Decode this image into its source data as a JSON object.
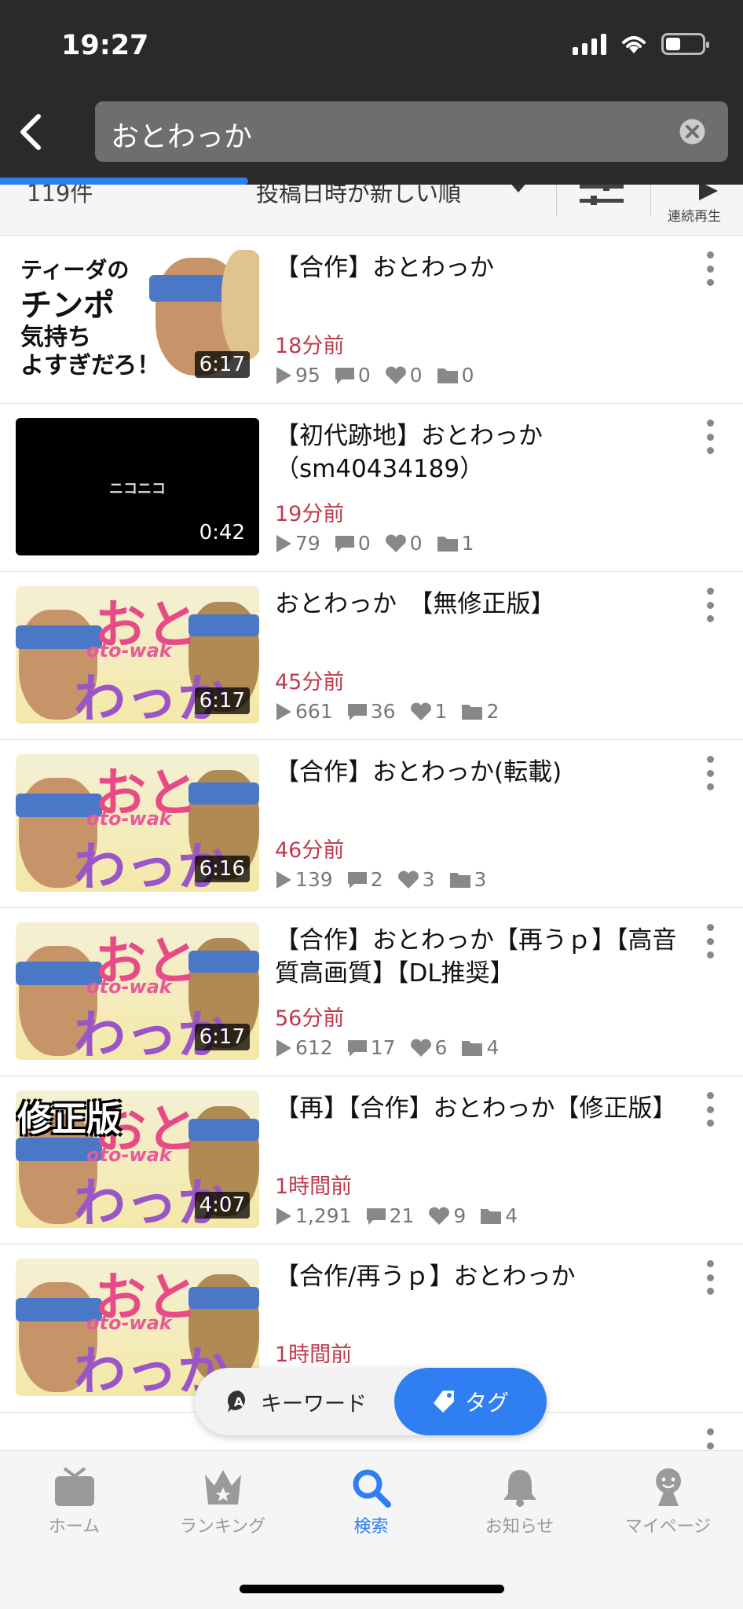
{
  "status_bar": {
    "time": "19:27"
  },
  "search": {
    "query": "おとわっか"
  },
  "sort_bar": {
    "result_count": "119件",
    "sort_order": "投稿日時が新しい順",
    "continuous_play": "連続再生"
  },
  "videos": [
    {
      "title": "【合作】おとわっか",
      "duration": "6:17",
      "posted": "18分前",
      "views": "95",
      "comments": "0",
      "likes": "0",
      "mylists": "0",
      "thumb_text": [
        "ティーダの",
        "チンポ",
        "気持ち",
        "よすぎだろ！"
      ]
    },
    {
      "title": "【初代跡地】おとわっか（sm40434189）",
      "duration": "0:42",
      "posted": "19分前",
      "views": "79",
      "comments": "0",
      "likes": "0",
      "mylists": "1",
      "thumb_text": [
        "ニコニコ"
      ]
    },
    {
      "title": "おとわっか　【無修正版】",
      "duration": "6:17",
      "posted": "45分前",
      "views": "661",
      "comments": "36",
      "likes": "1",
      "mylists": "2",
      "thumb_text": [
        "おと",
        "oto-wak",
        "わっか"
      ]
    },
    {
      "title": "【合作】おとわっか(転載)",
      "duration": "6:16",
      "posted": "46分前",
      "views": "139",
      "comments": "2",
      "likes": "3",
      "mylists": "3",
      "thumb_text": [
        "おと",
        "oto-wak",
        "わっか"
      ]
    },
    {
      "title": "【合作】おとわっか【再うｐ】【高音質高画質】【DL推奨】",
      "duration": "6:17",
      "posted": "56分前",
      "views": "612",
      "comments": "17",
      "likes": "6",
      "mylists": "4",
      "thumb_text": [
        "おと",
        "oto-wak",
        "わっか"
      ]
    },
    {
      "title": "【再】【合作】おとわっか【修正版】",
      "duration": "4:07",
      "posted": "1時間前",
      "views": "1,291",
      "comments": "21",
      "likes": "9",
      "mylists": "4",
      "thumb_text": [
        "修正版",
        "おと",
        "oto-wak",
        "わっか"
      ]
    },
    {
      "title": "【合作/再うｐ】おとわっか",
      "duration": "",
      "posted": "1時間前",
      "views": "",
      "comments": "",
      "likes": "",
      "mylists": "",
      "thumb_text": [
        "おと",
        "oto-wak",
        "わっか"
      ]
    }
  ],
  "mode_toggle": {
    "keyword": "キーワード",
    "tag": "タグ"
  },
  "bottom_nav": [
    {
      "label": "ホーム",
      "icon": "tv-icon"
    },
    {
      "label": "ランキング",
      "icon": "crown-icon"
    },
    {
      "label": "検索",
      "icon": "search-icon",
      "active": true
    },
    {
      "label": "お知らせ",
      "icon": "bell-icon"
    },
    {
      "label": "マイページ",
      "icon": "person-icon"
    }
  ],
  "colors": {
    "accent": "#2f7ff2",
    "posted_time": "#c0394b",
    "header": "#2a2a2a"
  }
}
